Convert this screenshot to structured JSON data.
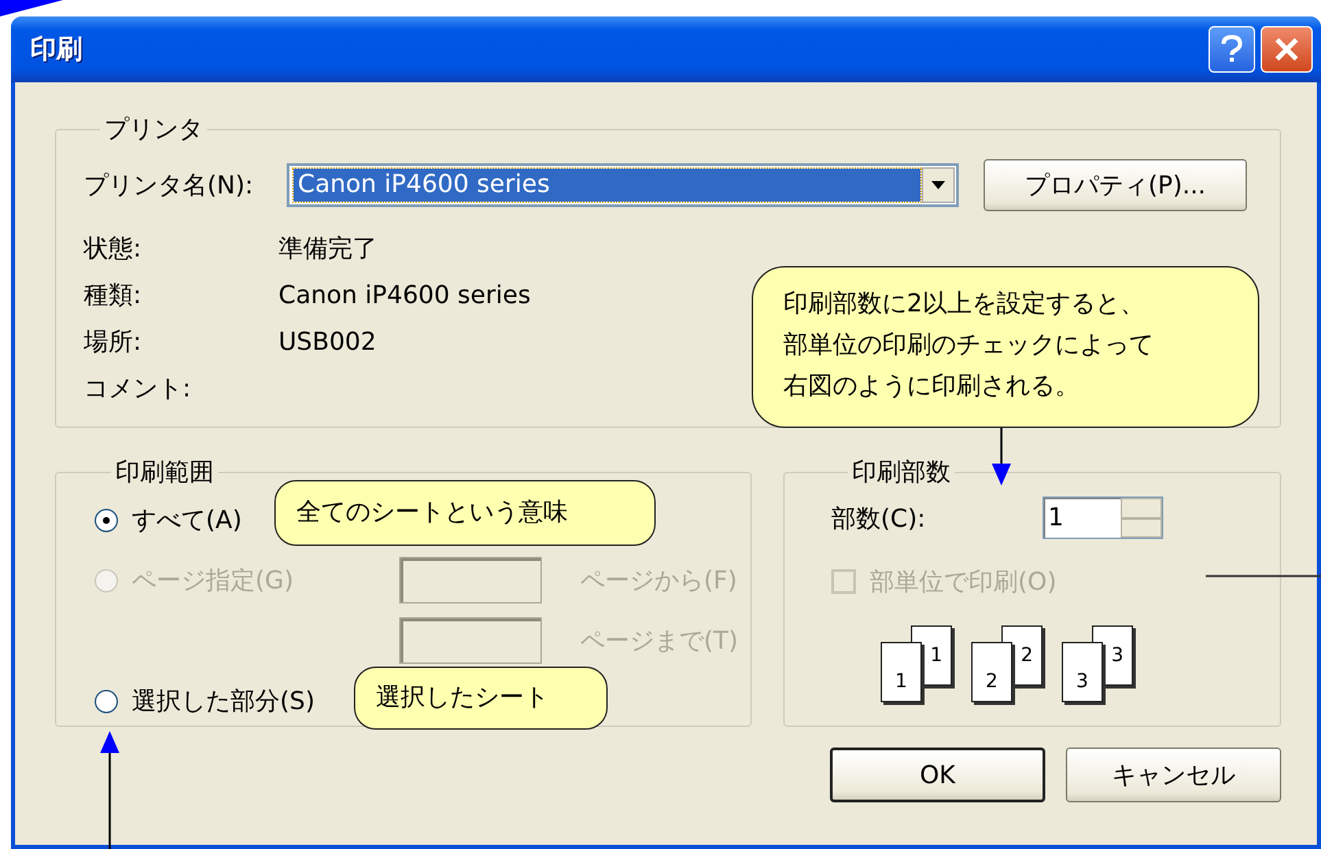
{
  "window": {
    "title": "印刷"
  },
  "printer": {
    "group_title": "プリンタ",
    "name_label": "プリンタ名(N):",
    "name_value": "Canon iP4600 series",
    "properties_button": "プロパティ(P)...",
    "info": [
      {
        "label": "状態:",
        "value": "準備完了"
      },
      {
        "label": "種類:",
        "value": "Canon iP4600 series"
      },
      {
        "label": "場所:",
        "value": "USB002"
      },
      {
        "label": "コメント:"
      }
    ]
  },
  "print_range": {
    "group_title": "印刷範囲",
    "options": [
      {
        "label": "すべて(A)",
        "selected": true,
        "disabled": false
      },
      {
        "label": "ページ指定(G)",
        "selected": false,
        "disabled": true
      },
      {
        "label": "選択した部分(S)",
        "selected": false,
        "disabled": false
      }
    ],
    "from_label": "ページから(F)",
    "to_label": "ページまで(T)"
  },
  "copies": {
    "group_title": "印刷部数",
    "count_label": "部数(C):",
    "count_value": "1",
    "collate": {
      "label": "部単位で印刷(O)",
      "checked": false,
      "disabled": true
    },
    "collate_pages": [
      [
        "1",
        "1"
      ],
      [
        "2",
        "2"
      ],
      [
        "3",
        "3"
      ]
    ]
  },
  "buttons": [
    "OK",
    "キャンセル"
  ],
  "callouts": [
    {
      "lines": [
        "印刷部数に2以上を設定すると、",
        "部単位の印刷のチェックによって",
        "右図のように印刷される。"
      ]
    },
    {
      "lines": [
        "全てのシートという意味"
      ]
    },
    {
      "lines": [
        "選択したシート"
      ]
    }
  ]
}
